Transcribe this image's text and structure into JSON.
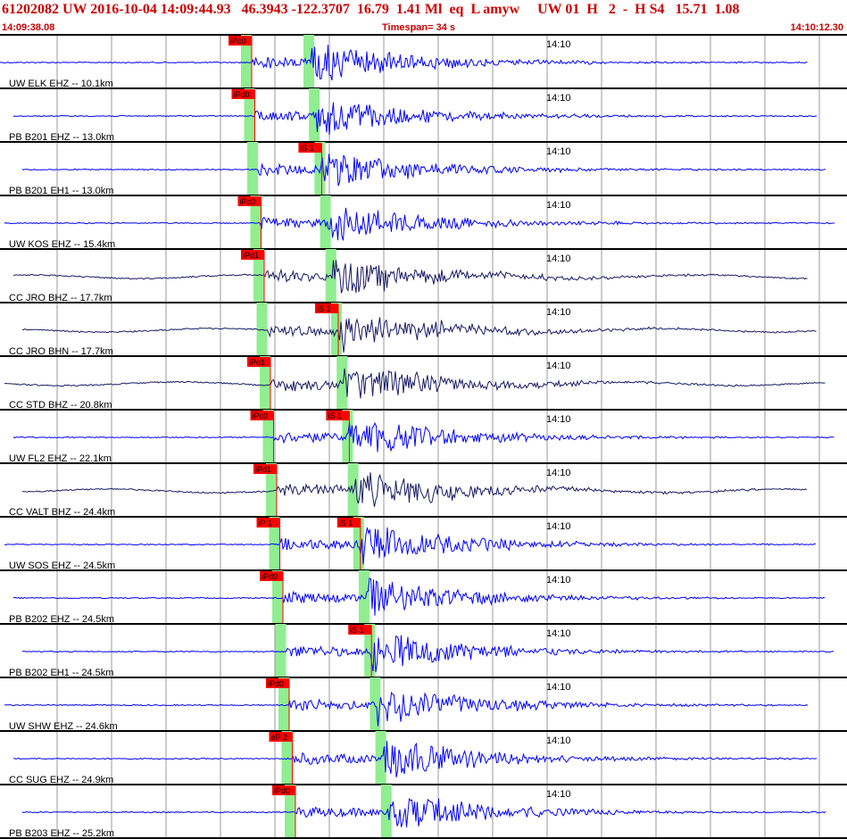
{
  "header": {
    "line1": "61202082 UW 2016-10-04 14:09:44.93   46.3943 -122.3707  16.79  1.41 Ml  eq  L amyw     UW 01  H   2  -  H S4   15.71  1.08",
    "start_time": "14:09:38.08",
    "timespan": "Timespan=  34 s",
    "end_time": "14:10:12.30"
  },
  "colors": {
    "header_red": "#cc0000",
    "trace_blue": "#0000ff",
    "trace_navy": "#1a1a66",
    "pick_red": "#ff0000",
    "window_green": "#90ee90",
    "grid_gray": "#999999"
  },
  "chart_data": {
    "type": "seismogram_record_section",
    "minute_marker_label": "14:10",
    "time_window_seconds": 34,
    "traces": [
      {
        "label": "UW ELK EHZ -- 10.1km",
        "color": "blue",
        "p_pick": "iPc0",
        "p_time": 6.2,
        "s_pick": "",
        "s_time": null,
        "dist_km": 10.1
      },
      {
        "label": "PB B201 EHZ -- 13.0km",
        "color": "blue",
        "p_pick": "iPd0",
        "p_time": 6.5,
        "s_pick": "",
        "s_time": null,
        "dist_km": 13.0
      },
      {
        "label": "PB B201 EH1 -- 13.0km",
        "color": "blue",
        "p_pick": "",
        "p_time": null,
        "s_pick": "iS 1",
        "s_time": 8.6,
        "dist_km": 13.0
      },
      {
        "label": "UW KOS EHZ -- 15.4km",
        "color": "blue",
        "p_pick": "iPc0",
        "p_time": 6.8,
        "s_pick": "",
        "s_time": 9.3,
        "dist_km": 15.4
      },
      {
        "label": "CC JRO BHZ -- 17.7km",
        "color": "navy",
        "p_pick": "iPd1",
        "p_time": 7.2,
        "s_pick": "",
        "s_time": null,
        "dist_km": 17.7
      },
      {
        "label": "CC JRO BHN -- 17.7km",
        "color": "navy",
        "p_pick": "",
        "p_time": null,
        "s_pick": "iS 1",
        "s_time": 9.4,
        "dist_km": 17.7
      },
      {
        "label": "CC STD BHZ -- 20.8km",
        "color": "navy",
        "p_pick": "iPd1",
        "p_time": 7.4,
        "s_pick": "",
        "s_time": null,
        "dist_km": 20.8
      },
      {
        "label": "UW FL2 EHZ -- 22.1km",
        "color": "blue",
        "p_pick": "iPc0",
        "p_time": 7.7,
        "s_pick": "iS 1",
        "s_time": 10.0,
        "dist_km": 22.1
      },
      {
        "label": "CC VALT BHZ -- 24.4km",
        "color": "navy",
        "p_pick": "iPd1",
        "p_time": 7.9,
        "s_pick": "",
        "s_time": null,
        "dist_km": 24.4
      },
      {
        "label": "UW SOS EHZ -- 24.5km",
        "color": "blue",
        "p_pick": "iP 1",
        "p_time": 7.9,
        "s_pick": "iS 1",
        "s_time": 10.3,
        "dist_km": 24.5
      },
      {
        "label": "PB B202 EHZ -- 24.5km",
        "color": "blue",
        "p_pick": "iPd0",
        "p_time": 7.8,
        "s_pick": "",
        "s_time": null,
        "dist_km": 24.5
      },
      {
        "label": "PB B202 EH1 -- 24.5km",
        "color": "blue",
        "p_pick": "",
        "p_time": null,
        "s_pick": "iS 1",
        "s_time": 10.2,
        "dist_km": 24.5
      },
      {
        "label": "UW SHW EHZ -- 24.6km",
        "color": "blue",
        "p_pick": "iPd0",
        "p_time": 7.9,
        "s_pick": "",
        "s_time": 11.5,
        "dist_km": 24.6
      },
      {
        "label": "CC SUG EHZ -- 24.9km",
        "color": "blue",
        "p_pick": "eP 2",
        "p_time": 8.1,
        "s_pick": "",
        "s_time": 12.0,
        "dist_km": 24.9
      },
      {
        "label": "PB B203 EHZ -- 25.2km",
        "color": "blue",
        "p_pick": "iPd0",
        "p_time": 7.9,
        "s_pick": "",
        "s_time": null,
        "dist_km": 25.2
      }
    ]
  }
}
